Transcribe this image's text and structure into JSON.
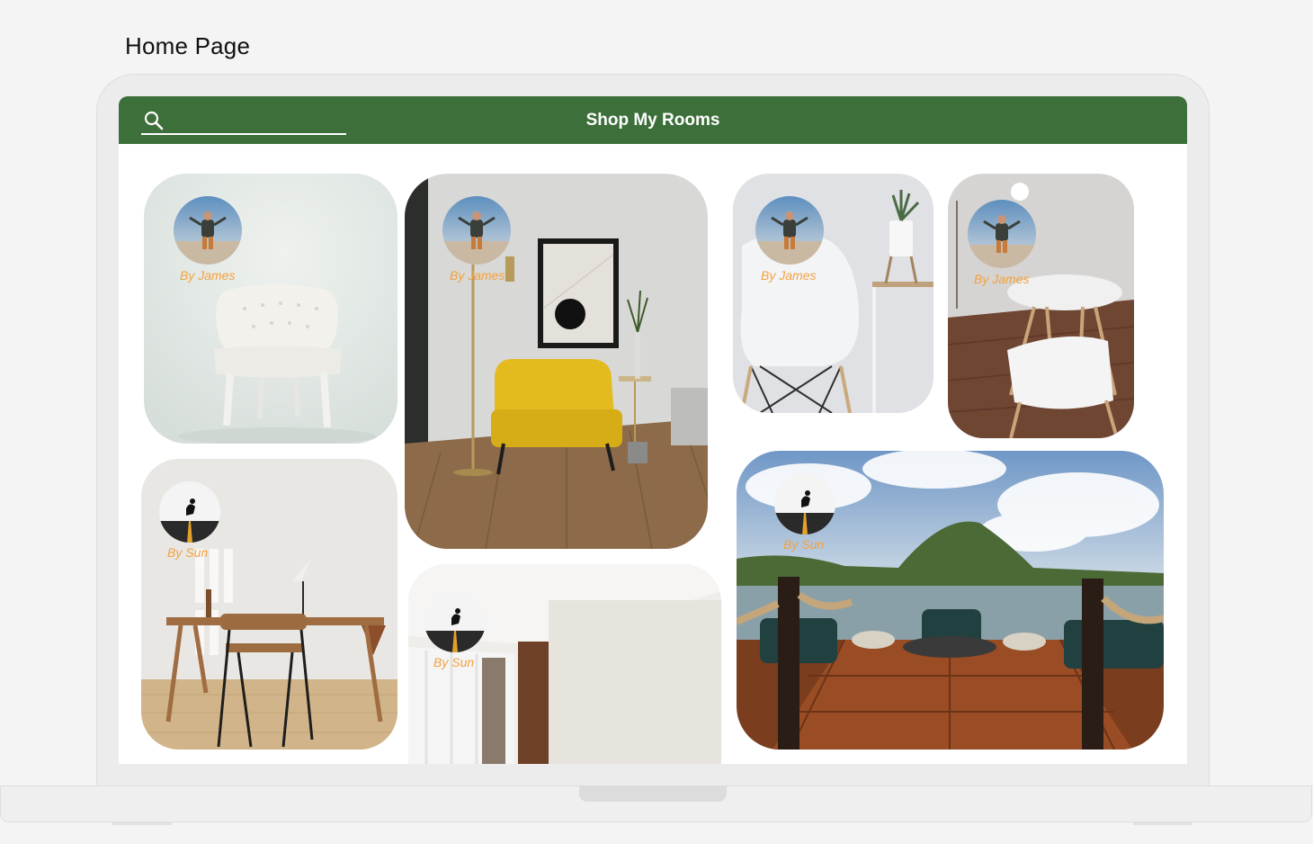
{
  "page_title": "Home Page",
  "app": {
    "title": "Shop My Rooms",
    "search": {
      "placeholder": "",
      "value": ""
    }
  },
  "cards": [
    {
      "id": "white-tufted-chair",
      "author": "By James",
      "avatar": "James"
    },
    {
      "id": "yellow-armchair",
      "author": "By James",
      "avatar": "James"
    },
    {
      "id": "white-chair-plant",
      "author": "By James",
      "avatar": "James"
    },
    {
      "id": "round-table",
      "author": "By James",
      "avatar": "James"
    },
    {
      "id": "wooden-desk",
      "author": "By Sun",
      "avatar": "Sun"
    },
    {
      "id": "room-window",
      "author": "By Sun",
      "avatar": "Sun"
    },
    {
      "id": "deck-seaside",
      "author": "By Sun",
      "avatar": "Sun"
    }
  ],
  "colors": {
    "appbar": "#3d6f3a",
    "byline": "#f4a13f",
    "background": "#f4f4f4"
  },
  "icons": {
    "search": "search-icon"
  }
}
